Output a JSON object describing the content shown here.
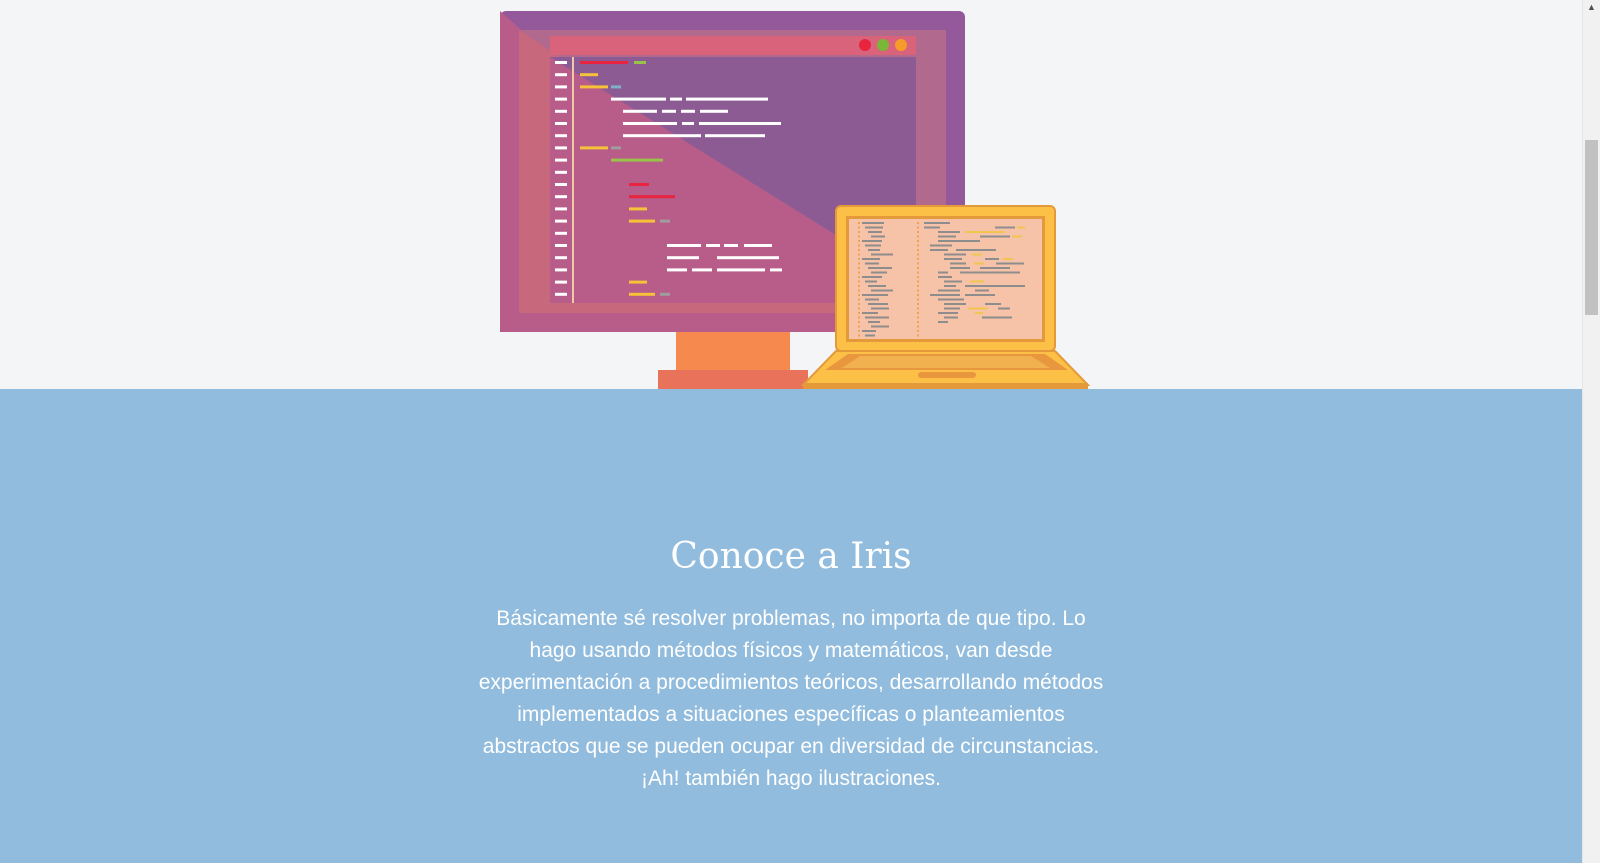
{
  "hero": {
    "illustration": "desktop-monitor-and-laptop-with-code",
    "colors": {
      "background": "#f4f5f7",
      "monitor_frame": "#93599a",
      "monitor_screen": "#b85c8a",
      "monitor_stand": "#f5894e",
      "laptop_body": "#fcc046",
      "laptop_screen": "#f6c2a8"
    }
  },
  "about": {
    "title": "Conoce a Iris",
    "lines": [
      "Básicamente sé resolver problemas, no importa de que tipo. Lo",
      "hago usando métodos físicos y matemáticos, van desde",
      "experimentación a procedimientos teóricos, desarrollando métodos",
      "implementados a situaciones específicas o planteamientos",
      "abstractos que se pueden ocupar en diversidad de circunstancias.",
      "¡Ah! también hago ilustraciones."
    ],
    "background_color": "#91bcdd",
    "text_color": "#ffffff"
  },
  "scrollbar": {
    "up_arrow_icon": "chevron-up-icon",
    "up_arrow_glyph": "▲"
  }
}
